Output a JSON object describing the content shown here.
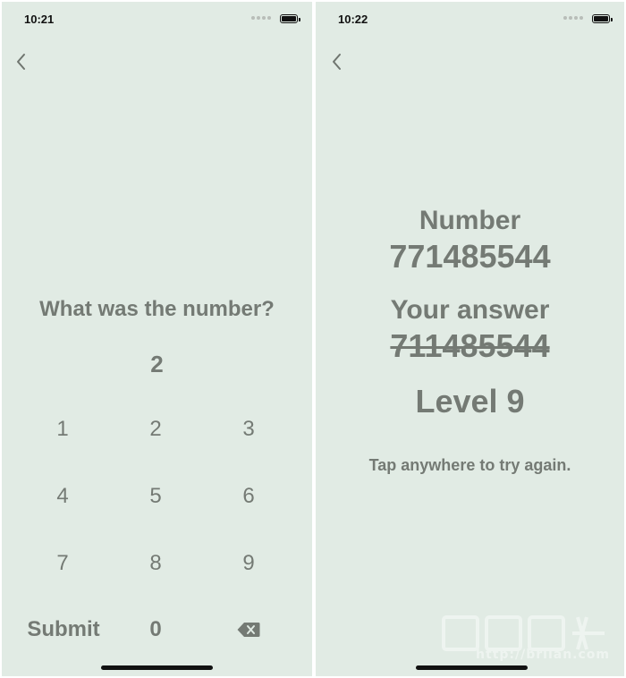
{
  "left_screen": {
    "status": {
      "time": "10:21"
    },
    "question": "What was the number?",
    "entry": "2",
    "keypad": {
      "rows": [
        [
          "1",
          "2",
          "3"
        ],
        [
          "4",
          "5",
          "6"
        ],
        [
          "7",
          "8",
          "9"
        ]
      ],
      "submit_label": "Submit",
      "zero_label": "0"
    }
  },
  "right_screen": {
    "status": {
      "time": "10:22"
    },
    "number_label": "Number",
    "number_value": "771485544",
    "answer_label": "Your answer",
    "answer_value": "711485544",
    "level": "Level 9",
    "hint": "Tap anywhere to try again."
  },
  "watermark": {
    "text": "http://briian.com"
  },
  "colors": {
    "background": "#e1ebe4",
    "text": "#747a74",
    "status_text": "#111111"
  },
  "icons": {
    "back": "chevron-left-icon",
    "backspace": "backspace-icon",
    "battery": "battery-icon",
    "signal": "signal-dots-icon"
  }
}
